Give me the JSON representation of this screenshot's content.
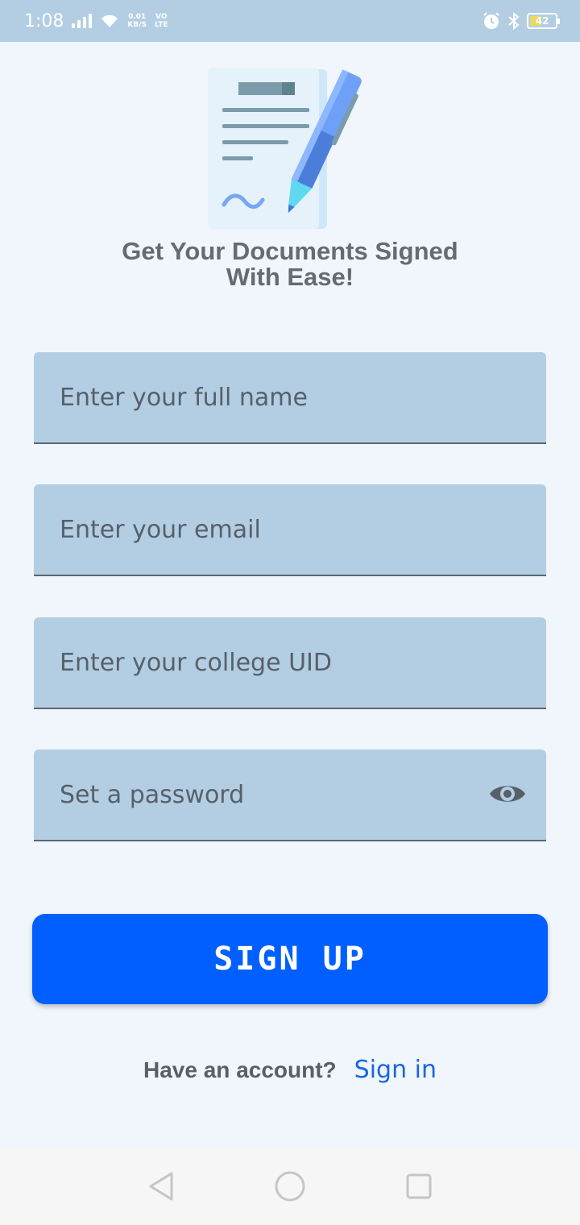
{
  "status_bar": {
    "time": "1:08",
    "net_speed_value": "0.01",
    "net_speed_unit": "KB/S",
    "net_type_top": "VO",
    "net_type_bottom": "LTE",
    "battery_level": "42",
    "icons": [
      "signal-icon",
      "wifi-icon",
      "alarm-icon",
      "bluetooth-icon",
      "battery-icon"
    ]
  },
  "headline": {
    "line1": "Get Your Documents Signed",
    "line2": "With Ease!"
  },
  "form": {
    "full_name_placeholder": "Enter your full name",
    "email_placeholder": "Enter your email",
    "college_uid_placeholder": "Enter your college UID",
    "password_placeholder": "Set a password",
    "password_toggle_icon": "eye-icon"
  },
  "signup_button": "SIGN UP",
  "footer": {
    "question": "Have an account?",
    "signin_link": "Sign in"
  },
  "nav_bar": {
    "icons": [
      "back-icon",
      "home-icon",
      "recents-icon"
    ]
  },
  "colors": {
    "status_bar": "#b3cee3",
    "background": "#f0f6fc",
    "field_fill": "#b3cee3",
    "primary_button": "#005ffe",
    "link": "#1a66e0"
  }
}
